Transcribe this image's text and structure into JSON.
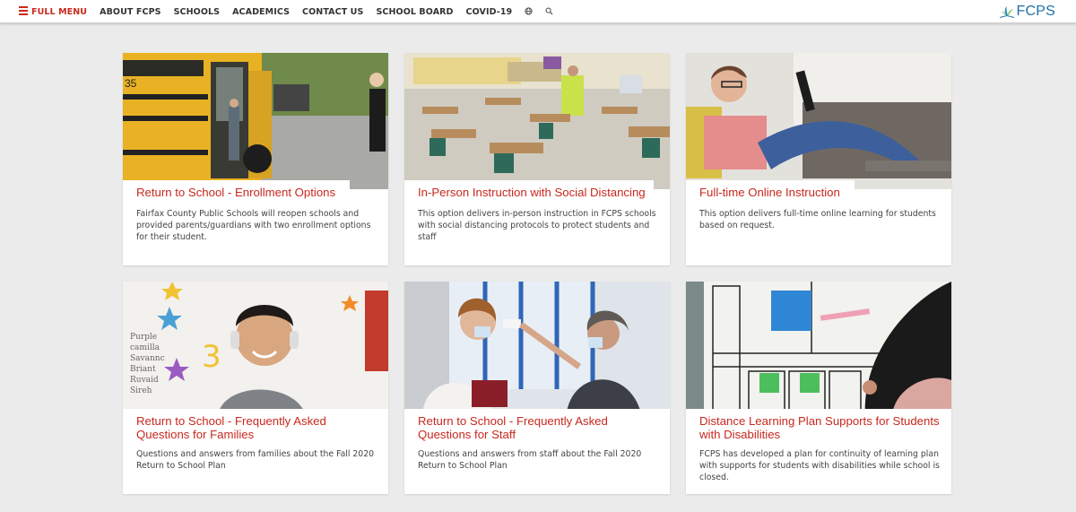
{
  "nav": {
    "full_menu": "FULL MENU",
    "items": [
      "ABOUT FCPS",
      "SCHOOLS",
      "ACADEMICS",
      "CONTACT US",
      "SCHOOL BOARD",
      "COVID-19"
    ],
    "globe_icon": "globe-icon",
    "search_icon": "search-icon",
    "logo_text": "FCPS"
  },
  "colors": {
    "accent": "#c8281e",
    "brand": "#1e6fa6",
    "background": "#ebebeb"
  },
  "cards": [
    {
      "title": "Return to School - Enrollment Options",
      "description": "Fairfax County Public Schools will reopen schools and provided parents/guardians with two enrollment options for their student."
    },
    {
      "title": "In-Person Instruction with Social Distancing",
      "description": "This option delivers in-person instruction in FCPS schools with social distancing protocols to protect students and staff"
    },
    {
      "title": "Full-time Online Instruction",
      "description": "This option delivers full-time online learning for students based on request."
    },
    {
      "title": "Return to School - Frequently Asked Questions for Families",
      "description": "Questions and answers from families about the Fall 2020 Return to School Plan"
    },
    {
      "title": "Return to School - Frequently Asked Questions for Staff",
      "description": "Questions and answers from staff about the Fall 2020 Return to School Plan"
    },
    {
      "title": "Distance Learning Plan Supports for Students with Disabilities",
      "description": "FCPS has developed a plan for continuity of learning plan with supports for students with disabilities while school is closed."
    }
  ]
}
